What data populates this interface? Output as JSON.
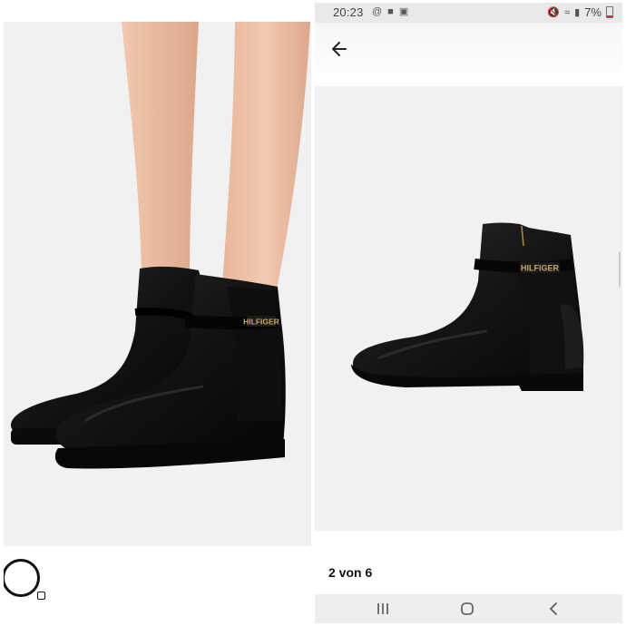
{
  "left": {
    "photo_label": "Woman wearing black leather ankle boots",
    "brand_plate": "HILFIGER"
  },
  "right": {
    "status_bar": {
      "time": "20:23",
      "battery": "7%"
    },
    "header": {
      "back_icon": "arrow-left-icon"
    },
    "product": {
      "brand_plate": "HILFIGER",
      "counter": "2 von 6"
    },
    "nav": {
      "recents_icon": "recents-icon",
      "home_icon": "home-icon",
      "back_icon": "chevron-left-icon"
    }
  },
  "colors": {
    "background": "#ffffff",
    "photo_bg": "#f1f1f1",
    "status_bar": "#e9e9e9",
    "nav_bar": "#eeeeee",
    "boot": "#141414",
    "plate": "#c8a862"
  }
}
